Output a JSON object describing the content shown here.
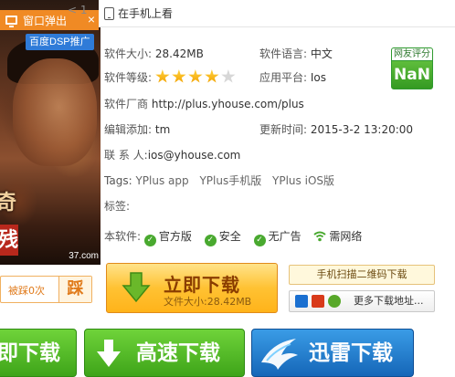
{
  "top": {
    "label": "在手机上看",
    "nav_left": "< 1"
  },
  "ad": {
    "popup_title": "窗口弹出",
    "close_glyph": "×",
    "tag": "百度DSP推广",
    "image_chars": [
      "奇",
      "残"
    ],
    "watermark": "37.com"
  },
  "info": {
    "size_label": "软件大小:",
    "size_value": "28.42MB",
    "lang_label": "软件语言:",
    "lang_value": "中文",
    "level_label": "软件等级:",
    "level_stars": 4,
    "level_max": 5,
    "platform_label": "应用平台:",
    "platform_value": "Ios",
    "vendor_label": "软件厂商",
    "vendor_value": "http://plus.yhouse.com/plus",
    "editor_label": "编辑添加:",
    "editor_value": "tm",
    "update_label": "更新时间:",
    "update_value": "2015-3-2 13:20:00",
    "contact_label": "联 系 人:",
    "contact_value": "ios@yhouse.com",
    "tags_label": "Tags:",
    "tags": [
      "YPlus app",
      "YPlus手机版",
      "YPlus iOS版"
    ],
    "labels_label": "标签:",
    "this_software_label": "本软件:",
    "features": [
      "官方版",
      "安全",
      "无广告",
      "需网络"
    ]
  },
  "rating": {
    "title": "网友评分",
    "value": "NaN"
  },
  "vote": {
    "count": "被踩0次",
    "button": "踩"
  },
  "download": {
    "main_label": "立即下载",
    "main_sub": "文件大小:28.42MB",
    "qr_label": "手机扫描二维码下载",
    "more_label": "更多下载地址..."
  },
  "bottom": {
    "btn1": "即下载",
    "btn2": "高速下载",
    "btn3": "迅雷下载"
  },
  "colors": {
    "accent_orange": "#f08a24",
    "green": "#49a92f",
    "blue": "#1566b8"
  }
}
